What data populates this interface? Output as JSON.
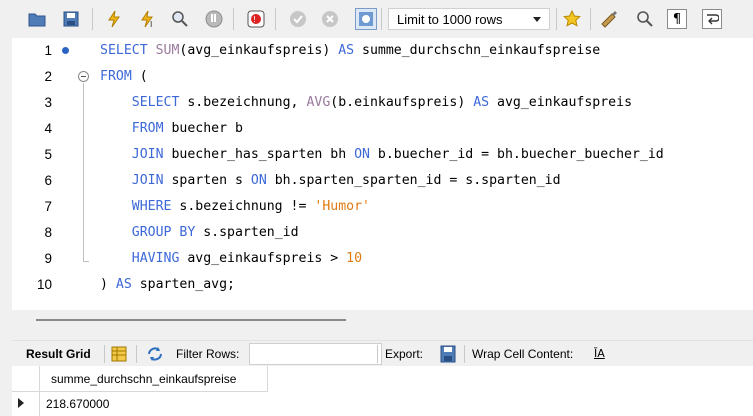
{
  "toolbar": {
    "icons": [
      "open-folder-icon",
      "save-icon",
      "execute-icon",
      "execute-current-icon",
      "explain-icon",
      "stop-icon",
      "toggle-continue-icon",
      "commit-icon",
      "rollback-icon",
      "autocommit-icon",
      "bookmark-star-icon",
      "beautify-icon",
      "find-icon",
      "invisible-chars-icon",
      "wrap-icon"
    ],
    "limit_label": "Limit to 1000 rows"
  },
  "editor": {
    "lines": [
      {
        "n": "1",
        "tokens": [
          [
            "kw",
            "SELECT "
          ],
          [
            "fn",
            "SUM"
          ],
          [
            "t",
            "(avg_einkaufspreis) "
          ],
          [
            "kw",
            "AS"
          ],
          [
            "t",
            " summe_durchschn_einkaufspreise"
          ]
        ]
      },
      {
        "n": "2",
        "tokens": [
          [
            "kw",
            "FROM"
          ],
          [
            "t",
            " ("
          ]
        ]
      },
      {
        "n": "3",
        "tokens": [
          [
            "t",
            "    "
          ],
          [
            "kw",
            "SELECT"
          ],
          [
            "t",
            " s.bezeichnung, "
          ],
          [
            "fn",
            "AVG"
          ],
          [
            "t",
            "(b.einkaufspreis) "
          ],
          [
            "kw",
            "AS"
          ],
          [
            "t",
            " avg_einkaufspreis"
          ]
        ]
      },
      {
        "n": "4",
        "tokens": [
          [
            "t",
            "    "
          ],
          [
            "kw",
            "FROM"
          ],
          [
            "t",
            " buecher b"
          ]
        ]
      },
      {
        "n": "5",
        "tokens": [
          [
            "t",
            "    "
          ],
          [
            "kw",
            "JOIN"
          ],
          [
            "t",
            " buecher_has_sparten bh "
          ],
          [
            "kw",
            "ON"
          ],
          [
            "t",
            " b.buecher_id = bh.buecher_buecher_id"
          ]
        ]
      },
      {
        "n": "6",
        "tokens": [
          [
            "t",
            "    "
          ],
          [
            "kw",
            "JOIN"
          ],
          [
            "t",
            " sparten s "
          ],
          [
            "kw",
            "ON"
          ],
          [
            "t",
            " bh.sparten_sparten_id = s.sparten_id"
          ]
        ]
      },
      {
        "n": "7",
        "tokens": [
          [
            "t",
            "    "
          ],
          [
            "kw",
            "WHERE"
          ],
          [
            "t",
            " s.bezeichnung != "
          ],
          [
            "str",
            "'Humor'"
          ]
        ]
      },
      {
        "n": "8",
        "tokens": [
          [
            "t",
            "    "
          ],
          [
            "kw",
            "GROUP BY"
          ],
          [
            "t",
            " s.sparten_id"
          ]
        ]
      },
      {
        "n": "9",
        "tokens": [
          [
            "t",
            "    "
          ],
          [
            "kw",
            "HAVING"
          ],
          [
            "t",
            " avg_einkaufspreis > "
          ],
          [
            "num",
            "10"
          ]
        ]
      },
      {
        "n": "10",
        "tokens": [
          [
            "t",
            ") "
          ],
          [
            "kw",
            "AS"
          ],
          [
            "t",
            " sparten_avg;"
          ]
        ]
      }
    ]
  },
  "result_toolbar": {
    "result_grid": "Result Grid",
    "filter_rows": "Filter Rows:",
    "filter_value": "",
    "export": "Export:",
    "wrap_cell": "Wrap Cell Content:"
  },
  "grid": {
    "columns": [
      "summe_durchschn_einkaufspreise"
    ],
    "rows": [
      [
        "218.670000"
      ]
    ]
  }
}
